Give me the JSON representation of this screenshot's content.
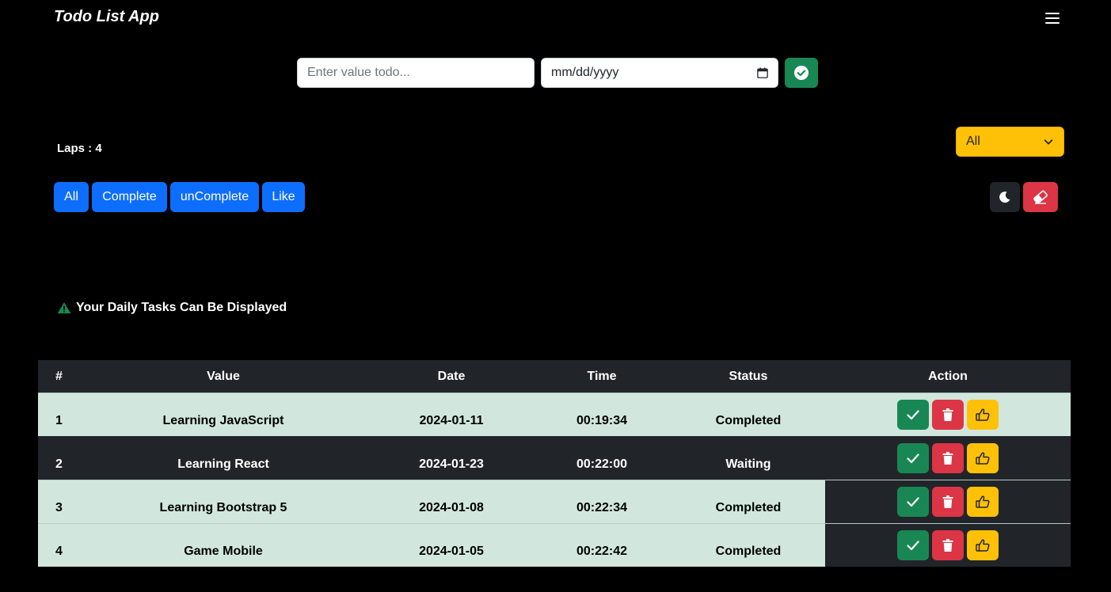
{
  "app": {
    "title": "Todo List App"
  },
  "form": {
    "todo_placeholder": "Enter value todo...",
    "date_placeholder": "mm/dd/yyyy"
  },
  "laps_text": "Laps : 4",
  "filter_select": {
    "value": "All"
  },
  "filters": [
    "All",
    "Complete",
    "unComplete",
    "Like"
  ],
  "alert_text": "Your Daily Tasks Can Be Displayed",
  "table": {
    "headers": [
      "#",
      "Value",
      "Date",
      "Time",
      "Status",
      "Action"
    ],
    "rows": [
      {
        "num": "1",
        "value": "Learning JavaScript",
        "date": "2024-01-11",
        "time": "00:19:34",
        "status": "Completed"
      },
      {
        "num": "2",
        "value": "Learning React",
        "date": "2024-01-23",
        "time": "00:22:00",
        "status": "Waiting"
      },
      {
        "num": "3",
        "value": "Learning Bootstrap 5",
        "date": "2024-01-08",
        "time": "00:22:34",
        "status": "Completed"
      },
      {
        "num": "4",
        "value": "Game Mobile",
        "date": "2024-01-05",
        "time": "00:22:42",
        "status": "Completed"
      }
    ]
  },
  "colors": {
    "success": "#198754",
    "danger": "#dc3545",
    "warning": "#ffc107",
    "primary": "#0d6efd",
    "dark": "#212529",
    "row_light": "#d1e7dd"
  },
  "icons": {
    "menu": "hamburger-icon",
    "add": "check-circle-icon",
    "select": "chevron-down-icon",
    "theme": "moon-icon",
    "clear": "eraser-icon",
    "alert": "warning-triangle-icon",
    "complete": "check-icon",
    "delete": "trash-icon",
    "like": "thumbs-up-icon"
  }
}
